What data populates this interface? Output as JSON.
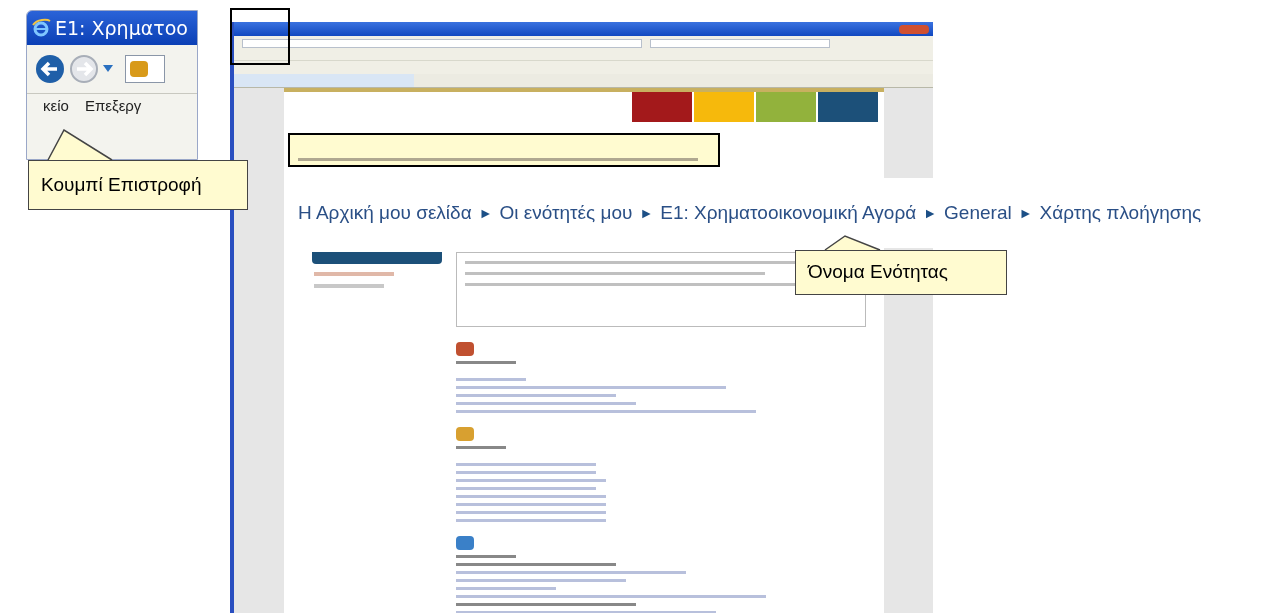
{
  "inset": {
    "title": "E1: Χρηματοο",
    "menu": [
      "κείο",
      "Επεξεργ"
    ]
  },
  "callouts": [
    {
      "kind": "back",
      "text": "Κουμπί Επιστροφή"
    },
    {
      "kind": "section",
      "text": "Όνομα Ενότητας"
    }
  ],
  "breadcrumb": {
    "items": [
      "Η Αρχική μου σελίδα",
      "Οι ενότητές μου",
      "E1: Χρηματοοικονομική Αγορά",
      "General",
      "Χάρτης πλοήγησης"
    ],
    "separators": [
      "►",
      "►",
      "►",
      "►"
    ]
  },
  "nav_tabs": [
    {
      "color": "#a3191b"
    },
    {
      "color": "#f6b90c"
    },
    {
      "color": "#92b23c"
    },
    {
      "color": "#1c5079"
    }
  ]
}
